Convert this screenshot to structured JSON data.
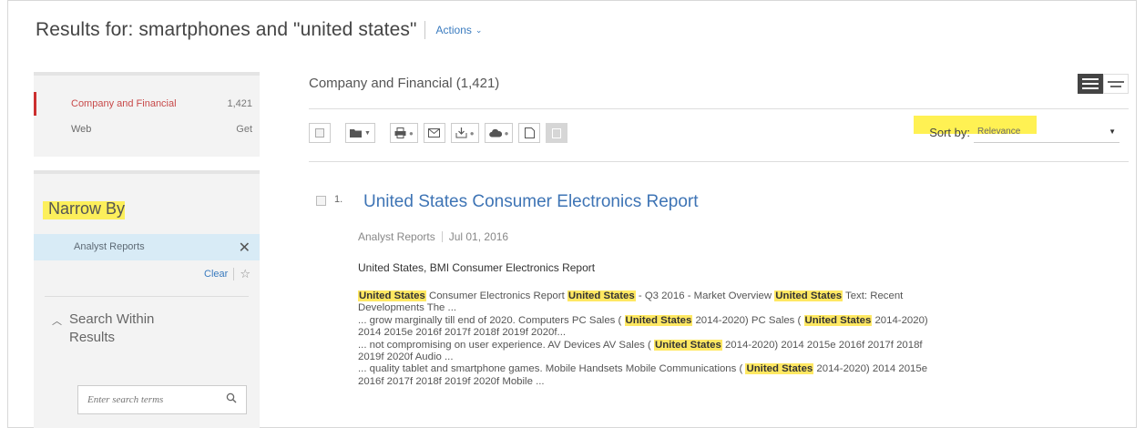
{
  "header": {
    "results_title": "Results for: smartphones and \"united states\"",
    "actions_label": "Actions",
    "actions_icon": "chevron-down-icon"
  },
  "sources": {
    "items": [
      {
        "label": "Company and Financial",
        "count": "1,421",
        "active": true
      },
      {
        "label": "Web",
        "count": "Get",
        "active": false
      }
    ],
    "active_color": "#cc2f2f"
  },
  "narrow": {
    "title": "Narrow By",
    "facet_label": "Analyst Reports",
    "facet_remove_icon": "close-icon",
    "clear_label": "Clear",
    "star_icon": "star-icon",
    "highlight_color": "#ffee28"
  },
  "search_within": {
    "title": "Search Within Results",
    "placeholder": "Enter search terms",
    "icon": "search-icon"
  },
  "main": {
    "title": "Company and Financial (1,421)",
    "sort_label": "Sort by:",
    "sort_value": "Relevance"
  },
  "result": {
    "number": "1.",
    "title": "United States Consumer Electronics Report",
    "type": "Analyst Reports",
    "date": "Jul 01, 2016",
    "subtitle": "United States, BMI Consumer Electronics Report",
    "snippet_lines": [
      [
        {
          "t": "United States",
          "h": true
        },
        {
          "t": " Consumer Electronics Report ",
          "h": false
        },
        {
          "t": "United States",
          "h": true
        },
        {
          "t": " - Q3 2016 - Market Overview ",
          "h": false
        },
        {
          "t": "United States",
          "h": true
        },
        {
          "t": " Text: Recent",
          "h": false
        }
      ],
      [
        {
          "t": "Developments The ...",
          "h": false
        }
      ],
      [
        {
          "t": "... grow marginally till end of 2020. Computers PC Sales ( ",
          "h": false
        },
        {
          "t": "United States",
          "h": true
        },
        {
          "t": " 2014-2020) PC Sales ( ",
          "h": false
        },
        {
          "t": "United States",
          "h": true
        },
        {
          "t": " 2014-2020)",
          "h": false
        }
      ],
      [
        {
          "t": "2014 2015e 2016f 2017f 2018f 2019f 2020f...",
          "h": false
        }
      ],
      [
        {
          "t": "... not compromising on user experience. AV Devices AV Sales ( ",
          "h": false
        },
        {
          "t": "United States",
          "h": true
        },
        {
          "t": " 2014-2020) 2014 2015e 2016f 2017f 2018f",
          "h": false
        }
      ],
      [
        {
          "t": "2019f 2020f Audio ...",
          "h": false
        }
      ],
      [
        {
          "t": "... quality tablet and smartphone games. Mobile Handsets Mobile Communications ( ",
          "h": false
        },
        {
          "t": "United States",
          "h": true
        },
        {
          "t": " 2014-2020) 2014 2015e",
          "h": false
        }
      ],
      [
        {
          "t": "2016f 2017f 2018f 2019f 2020f Mobile ...",
          "h": false
        }
      ]
    ]
  },
  "colors": {
    "link": "#3e74b5",
    "highlight": "#ffe862",
    "facet_bg": "#d8ebf6"
  }
}
